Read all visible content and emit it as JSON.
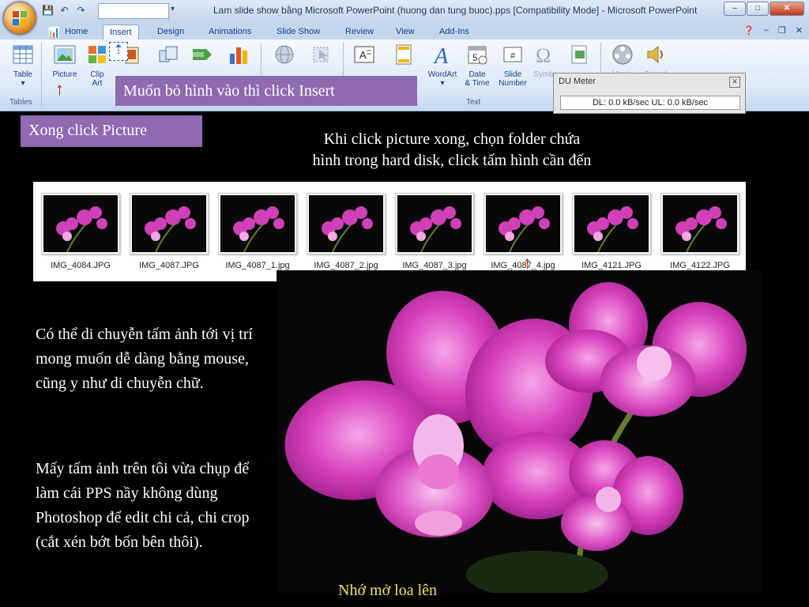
{
  "window": {
    "title": "Lam slide show bằng Microsoft PowerPoint (huong dan tung buoc).pps [Compatibility Mode] - Microsoft PowerPoint"
  },
  "tabs": [
    {
      "label": "Home"
    },
    {
      "label": "Insert"
    },
    {
      "label": "Design"
    },
    {
      "label": "Animations"
    },
    {
      "label": "Slide Show"
    },
    {
      "label": "Review"
    },
    {
      "label": "View"
    },
    {
      "label": "Add-Ins"
    }
  ],
  "ribbon": {
    "table_label": "Table",
    "picture_label": "Picture",
    "clipart_label_1": "Clip",
    "clipart_label_2": "Art",
    "group_tables": "Tables",
    "wordart_label": "WordArt",
    "datetime_label_1": "Date",
    "datetime_label_2": "& Time",
    "slidenumber_label_1": "Slide",
    "slidenumber_label_2": "Number",
    "symbol_label": "Symb",
    "movie_label": "Movie",
    "sound_label": "Sound",
    "group_text": "Text"
  },
  "dumeter": {
    "title": "DU Meter",
    "readout": "DL: 0.0 kB/sec  UL: 0.0 kB/sec"
  },
  "callouts": {
    "insert": "Muốn bỏ hình vào thì click Insert",
    "picture": "Xong click Picture"
  },
  "instruction": {
    "line1": "Khi click picture xong, chọn folder chứa",
    "line2": "hình trong hard disk, click tấm hình cần đến"
  },
  "files": [
    {
      "name": "IMG_4084.JPG"
    },
    {
      "name": "IMG_4087.JPG"
    },
    {
      "name": "IMG_4087_1.jpg"
    },
    {
      "name": "IMG_4087_2.jpg"
    },
    {
      "name": "IMG_4087_3.jpg"
    },
    {
      "name": "IMG_4087_4.jpg"
    },
    {
      "name": "IMG_4121.JPG"
    },
    {
      "name": "IMG_4122.JPG"
    }
  ],
  "body": {
    "para1": "Có thể di chuyễn tấm ảnh tới vị trí mong muốn dễ dàng bằng mouse, cũng y như di chuyễn chữ.",
    "para2": "Mấy tấm ảnh trên tôi vừa chụp để làm cái PPS nầy không dùng Photoshop để edit chi cả, chi crop (cắt xén bớt bốn bên thôi).",
    "sound_note": "Nhớ mở loa lên"
  },
  "colors": {
    "callout_bg": "#8e6ab0",
    "arrow": "#d01010",
    "note_yellow": "#f1e25b",
    "orchid": "#d040b8"
  }
}
